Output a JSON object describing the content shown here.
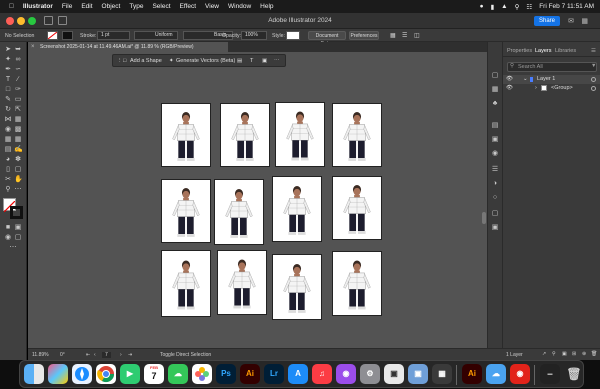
{
  "menubar": {
    "apple": "",
    "app": "Illustrator",
    "items": [
      "File",
      "Edit",
      "Object",
      "Type",
      "Select",
      "Effect",
      "View",
      "Window",
      "Help"
    ],
    "clock": "Fri Feb 7  11:51 AM"
  },
  "window": {
    "title": "Adobe Illustrator 2024",
    "share_label": "Share"
  },
  "controlbar": {
    "selection": "No Selection",
    "stroke_label": "Stroke:",
    "stroke_weight": "1 pt",
    "profile": "Uniform",
    "brush": "Basic",
    "opacity_label": "Opacity:",
    "opacity_value": "100%",
    "style_label": "Style:",
    "doc_setup": "Document Setup",
    "preferences": "Preferences"
  },
  "document": {
    "tab_title": "Screenshot 2025-01-14 at 11.49.46AM.ai* @ 11.89 % (RGB/Preview)"
  },
  "taskbar": {
    "add_shape": "Add a Shape",
    "generate_vectors": "Generate Vectors (Beta)"
  },
  "panel": {
    "tabs": [
      "Properties",
      "Layers",
      "Libraries"
    ],
    "active_tab": "Layers",
    "search_placeholder": "Search All",
    "layer_name": "Layer 1",
    "sublayer_name": "<Group>",
    "layer_count": "1 Layer"
  },
  "statusbar": {
    "zoom": "11.89%",
    "rotation": "0°",
    "artboard_num": "7",
    "tool_hint": "Toggle Direct Selection"
  },
  "dock": {
    "calendar_month": "FEB",
    "calendar_day": "7",
    "apps": [
      "finder-icon",
      "launchpad-icon",
      "safari-icon",
      "chrome-icon",
      "facetime-icon",
      "calendar-icon",
      "messages-icon",
      "photos-icon",
      "photoshop-icon",
      "illustrator-icon",
      "lightroom-icon",
      "app-store-icon",
      "music-icon",
      "podcasts-icon",
      "settings-icon",
      "roblox-icon",
      "preview-icon",
      "maps-icon",
      "illustrator-icon-2",
      "weather-icon",
      "photo-booth-icon",
      "downloads-stack-icon",
      "trash-icon"
    ]
  },
  "colors": {
    "accent": "#1473e6",
    "layer_color": "#4a7dff",
    "canvas": "#535353"
  }
}
